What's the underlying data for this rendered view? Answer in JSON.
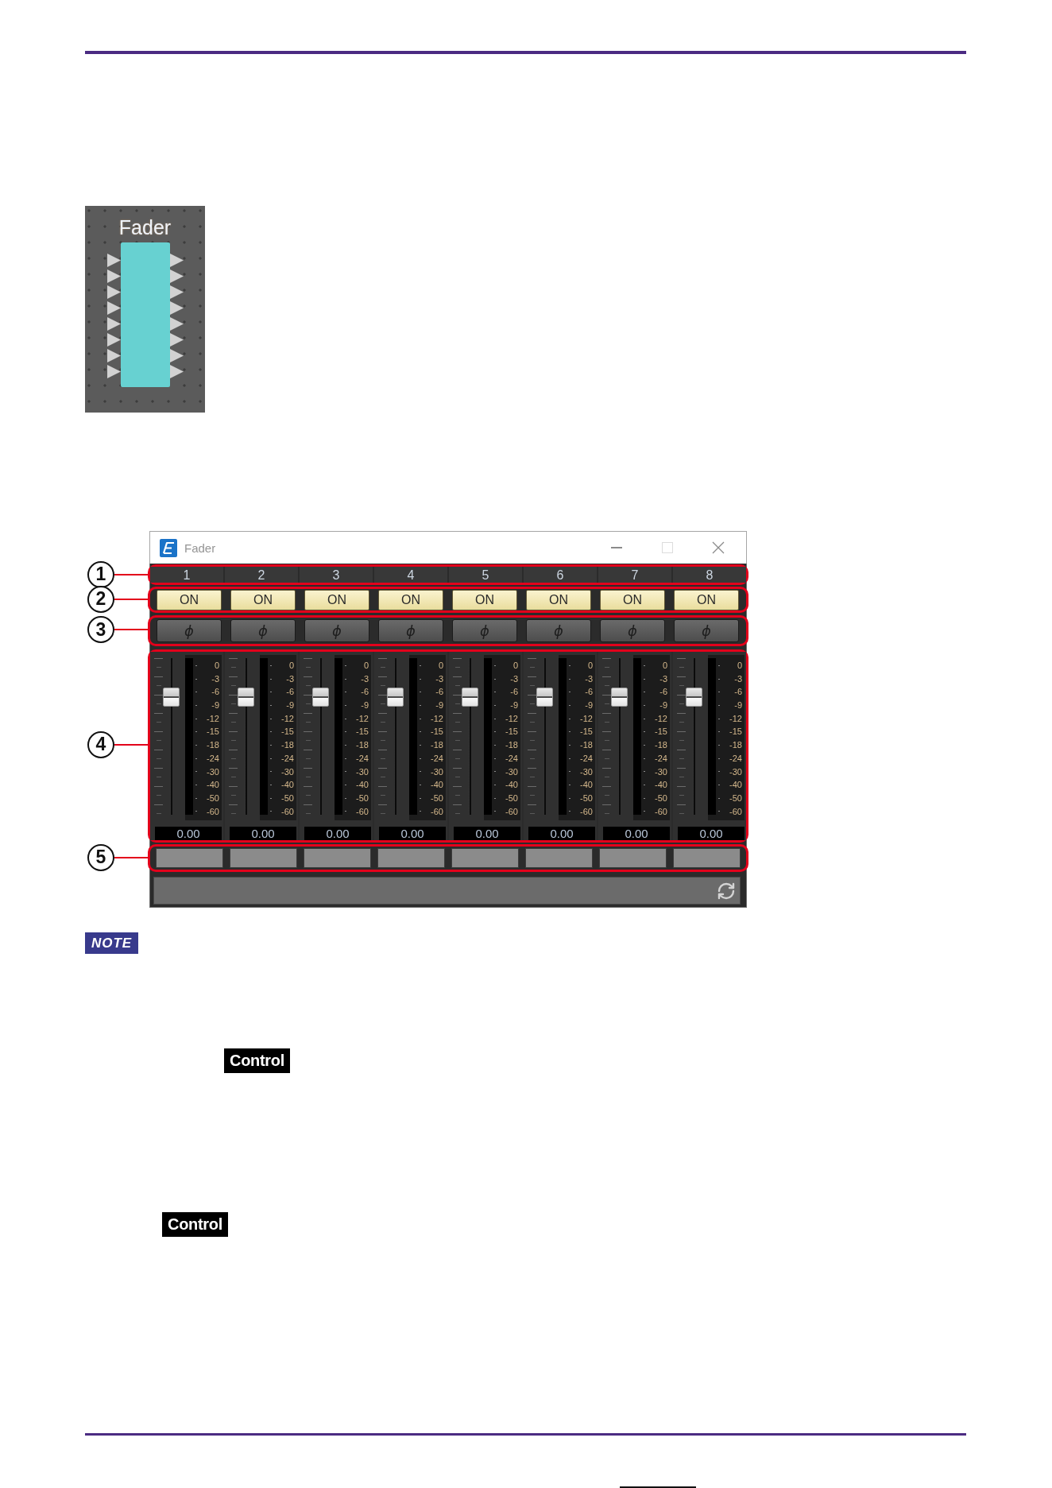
{
  "component": {
    "title": "Fader"
  },
  "window": {
    "title": "Fader",
    "controls": [
      {
        "kind": "minimize",
        "disabled": false
      },
      {
        "kind": "maximize",
        "disabled": true
      },
      {
        "kind": "close",
        "disabled": false
      }
    ]
  },
  "callouts": [
    {
      "number": "1"
    },
    {
      "number": "2"
    },
    {
      "number": "3"
    },
    {
      "number": "4"
    },
    {
      "number": "5"
    }
  ],
  "channels": [
    {
      "number": "1",
      "on_label": "ON",
      "on": true,
      "phase_label": "ϕ",
      "phase_invert": false,
      "level": 0.75,
      "value": "0.00",
      "meter_scale": [
        "0",
        "-3",
        "-6",
        "-9",
        "-12",
        "-15",
        "-18",
        "-24",
        "-30",
        "-40",
        "-50",
        "-60"
      ]
    },
    {
      "number": "2",
      "on_label": "ON",
      "on": true,
      "phase_label": "ϕ",
      "phase_invert": false,
      "level": 0.75,
      "value": "0.00",
      "meter_scale": [
        "0",
        "-3",
        "-6",
        "-9",
        "-12",
        "-15",
        "-18",
        "-24",
        "-30",
        "-40",
        "-50",
        "-60"
      ]
    },
    {
      "number": "3",
      "on_label": "ON",
      "on": true,
      "phase_label": "ϕ",
      "phase_invert": false,
      "level": 0.75,
      "value": "0.00",
      "meter_scale": [
        "0",
        "-3",
        "-6",
        "-9",
        "-12",
        "-15",
        "-18",
        "-24",
        "-30",
        "-40",
        "-50",
        "-60"
      ]
    },
    {
      "number": "4",
      "on_label": "ON",
      "on": true,
      "phase_label": "ϕ",
      "phase_invert": false,
      "level": 0.75,
      "value": "0.00",
      "meter_scale": [
        "0",
        "-3",
        "-6",
        "-9",
        "-12",
        "-15",
        "-18",
        "-24",
        "-30",
        "-40",
        "-50",
        "-60"
      ]
    },
    {
      "number": "5",
      "on_label": "ON",
      "on": true,
      "phase_label": "ϕ",
      "phase_invert": false,
      "level": 0.75,
      "value": "0.00",
      "meter_scale": [
        "0",
        "-3",
        "-6",
        "-9",
        "-12",
        "-15",
        "-18",
        "-24",
        "-30",
        "-40",
        "-50",
        "-60"
      ]
    },
    {
      "number": "6",
      "on_label": "ON",
      "on": true,
      "phase_label": "ϕ",
      "phase_invert": false,
      "level": 0.75,
      "value": "0.00",
      "meter_scale": [
        "0",
        "-3",
        "-6",
        "-9",
        "-12",
        "-15",
        "-18",
        "-24",
        "-30",
        "-40",
        "-50",
        "-60"
      ]
    },
    {
      "number": "7",
      "on_label": "ON",
      "on": true,
      "phase_label": "ϕ",
      "phase_invert": false,
      "level": 0.75,
      "value": "0.00",
      "meter_scale": [
        "0",
        "-3",
        "-6",
        "-9",
        "-12",
        "-15",
        "-18",
        "-24",
        "-30",
        "-40",
        "-50",
        "-60"
      ]
    },
    {
      "number": "8",
      "on_label": "ON",
      "on": true,
      "phase_label": "ϕ",
      "phase_invert": false,
      "level": 0.75,
      "value": "0.00",
      "meter_scale": [
        "0",
        "-3",
        "-6",
        "-9",
        "-12",
        "-15",
        "-18",
        "-24",
        "-30",
        "-40",
        "-50",
        "-60"
      ]
    }
  ],
  "note": {
    "badge": "NOTE"
  },
  "control_tags": [
    {
      "label": "Control"
    },
    {
      "label": "Control"
    }
  ]
}
